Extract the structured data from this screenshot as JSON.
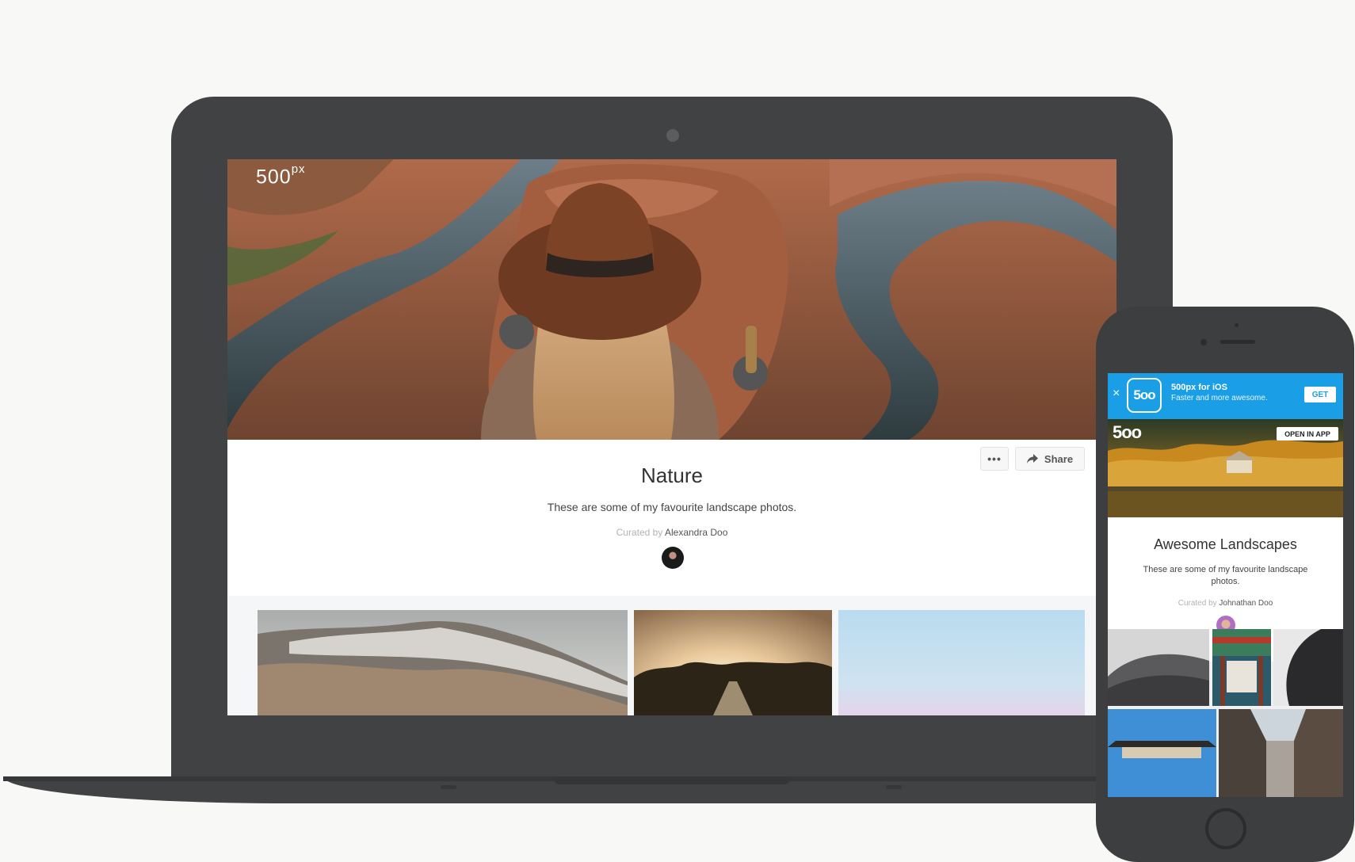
{
  "desktop": {
    "logo_text": "500",
    "logo_sup": "px",
    "title": "Nature",
    "description": "These are some of my favourite landscape photos.",
    "curated_prefix": "Curated by",
    "curator": "Alexandra Doo",
    "more_label": "•••",
    "share_label": "Share"
  },
  "mobile": {
    "banner": {
      "close": "×",
      "icon_text": "5oo",
      "title": "500px for iOS",
      "subtitle": "Faster and more awesome.",
      "get_label": "GET"
    },
    "logo_text": "5oo",
    "open_app_label": "OPEN IN APP",
    "title": "Awesome Landscapes",
    "description": "These are some of my favourite landscape photos.",
    "curated_prefix": "Curated by",
    "curator": "Johnathan Doo"
  },
  "icons": {
    "share": "share-arrow-icon",
    "more": "ellipsis-icon",
    "close": "close-icon"
  },
  "colors": {
    "device_body": "#404244",
    "banner_blue": "#1a9ee6",
    "background": "#f8f8f6"
  }
}
